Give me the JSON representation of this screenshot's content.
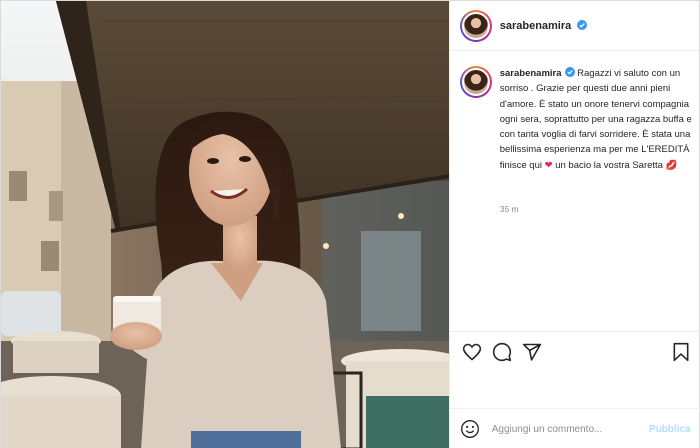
{
  "post": {
    "username": "sarabenamira",
    "caption": "Ragazzi vi saluto con un sorriso . Grazie per questi due anni pieni d'amore. È stato un onore tenervi compagnia ogni sera, soprattutto per una ragazza buffa e con tanta voglia di farvi sorridere. È stata una bellissima esperienza ma per me L'EREDITÀ finisce qui",
    "caption_tail": "un bacio la vostra Saretta",
    "emoji_heart": "❤",
    "emoji_kiss": "💋",
    "timestamp": "35 m"
  },
  "comment": {
    "placeholder": "Aggiungi un commento...",
    "publish_label": "Pubblica"
  },
  "icons": {
    "verified": "verified-badge-icon",
    "like": "heart-outline-icon",
    "comment": "comment-bubble-icon",
    "share": "paper-plane-icon",
    "save": "bookmark-icon",
    "emoji": "smiley-icon"
  },
  "colors": {
    "verified": "#3897f0",
    "publish_disabled": "#b2dffc",
    "muted_text": "#8e8e8e"
  }
}
